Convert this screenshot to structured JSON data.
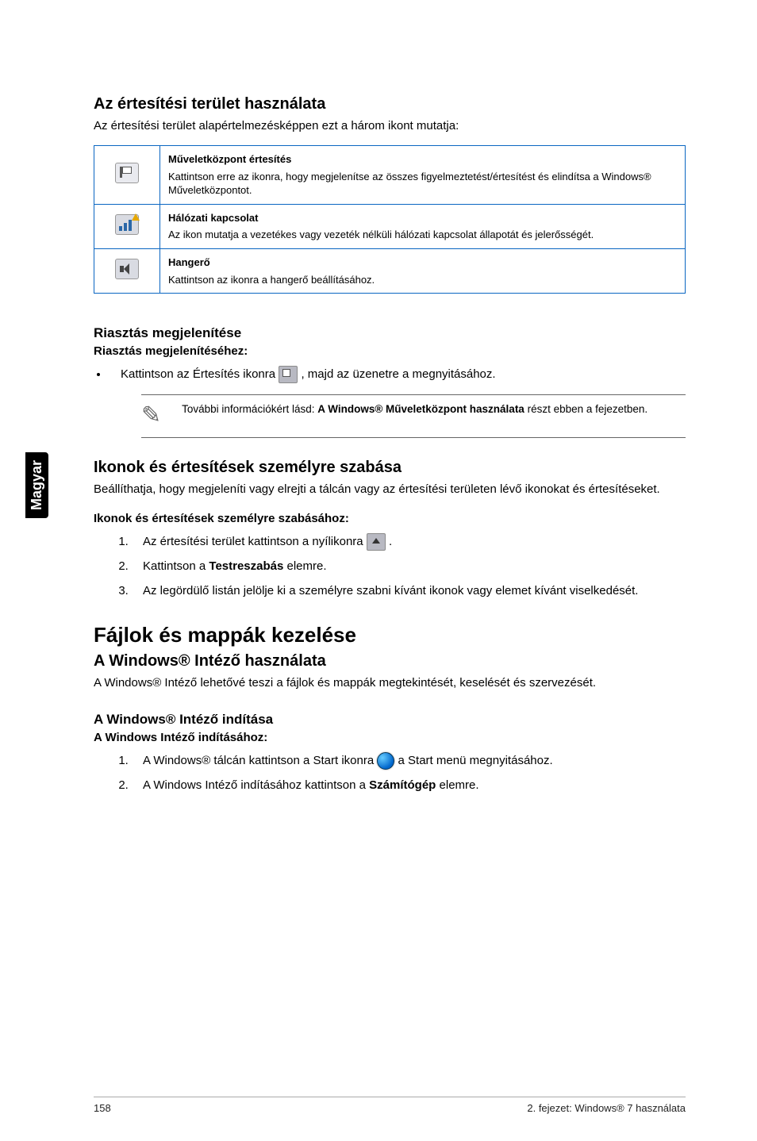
{
  "side_tab": "Magyar",
  "s1": {
    "title": "Az értesítési terület használata",
    "intro": "Az értesítési terület alapértelmezésképpen ezt a három ikont mutatja:",
    "rows": [
      {
        "title": "Műveletközpont értesítés",
        "desc": "Kattintson erre az ikonra, hogy megjelenítse az összes figyelmeztetést/értesítést és elindítsa a Windows® Műveletközpontot."
      },
      {
        "title": "Hálózati kapcsolat",
        "desc": "Az ikon mutatja a vezetékes vagy vezeték nélküli hálózati kapcsolat állapotát és jelerősségét."
      },
      {
        "title": "Hangerő",
        "desc": "Kattintson az ikonra a hangerő beállításához."
      }
    ]
  },
  "s2": {
    "title": "Riasztás megjelenítése",
    "sub": "Riasztás megjelenítéséhez:",
    "bullet_a": "Kattintson az Értesítés ikonra ",
    "bullet_b": ", majd az üzenetre a megnyitásához.",
    "note_a": "További információkért lásd: ",
    "note_bold": "A Windows® Műveletközpont használata",
    "note_b": " részt ebben a fejezetben."
  },
  "s3": {
    "title": "Ikonok és értesítések személyre szabása",
    "intro": "Beállíthatja, hogy megjeleníti vagy elrejti a tálcán vagy az értesítési területen lévő ikonokat és értesítéseket.",
    "sub": "Ikonok és értesítések személyre szabásához:",
    "steps": {
      "s1a": "Az értesítési terület kattintson a nyílikonra ",
      "s1b": ".",
      "s2a": "Kattintson a ",
      "s2bold": "Testreszabás",
      "s2b": " elemre.",
      "s3": "Az legördülő listán jelölje ki a személyre szabni kívánt ikonok vagy elemet kívánt viselkedését."
    }
  },
  "s4": {
    "main": "Fájlok és mappák kezelése",
    "sub": "A Windows® Intéző használata",
    "intro": "A Windows® Intéző lehetővé teszi a fájlok és mappák megtekintését, keselését és szervezését.",
    "mini": "A Windows® Intéző indítása",
    "subbold": "A Windows Intéző indításához:",
    "steps": {
      "s1a": "A Windows® tálcán kattintson a Start ikonra ",
      "s1b": " a Start menü megnyitásához.",
      "s2a": "A Windows Intéző indításához kattintson a ",
      "s2bold": "Számítógép",
      "s2b": " elemre."
    }
  },
  "footer": {
    "page": "158",
    "chapter": "2. fejezet: Windows® 7 használata"
  }
}
